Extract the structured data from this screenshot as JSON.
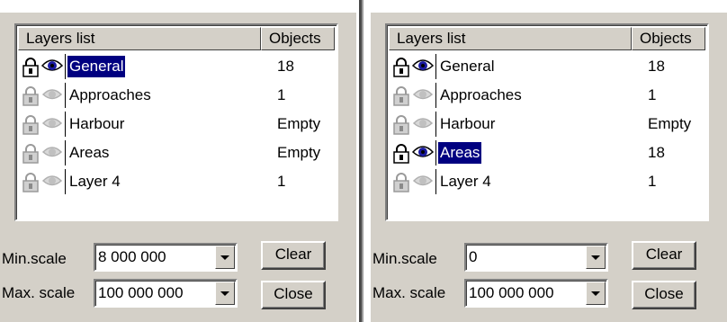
{
  "panels": [
    {
      "header": {
        "name": "Layers list",
        "objects": "Objects"
      },
      "layers": [
        {
          "name": "General",
          "objects": "18",
          "active": true,
          "selected": true
        },
        {
          "name": "Approaches",
          "objects": "1",
          "active": false,
          "selected": false
        },
        {
          "name": "Harbour",
          "objects": "Empty",
          "active": false,
          "selected": false
        },
        {
          "name": "Areas",
          "objects": "Empty",
          "active": false,
          "selected": false
        },
        {
          "name": "Layer 4",
          "objects": "1",
          "active": false,
          "selected": false
        }
      ],
      "min_scale_label": "Min.scale",
      "min_scale_value": "8 000 000",
      "max_scale_label": "Max. scale",
      "max_scale_value": "100 000 000",
      "clear_label": "Clear",
      "close_label": "Close"
    },
    {
      "header": {
        "name": "Layers list",
        "objects": "Objects"
      },
      "layers": [
        {
          "name": "General",
          "objects": "18",
          "active": true,
          "selected": false
        },
        {
          "name": "Approaches",
          "objects": "1",
          "active": false,
          "selected": false
        },
        {
          "name": "Harbour",
          "objects": "Empty",
          "active": false,
          "selected": false
        },
        {
          "name": "Areas",
          "objects": "18",
          "active": true,
          "selected": true
        },
        {
          "name": "Layer 4",
          "objects": "1",
          "active": false,
          "selected": false
        }
      ],
      "min_scale_label": "Min.scale",
      "min_scale_value": "0",
      "max_scale_label": "Max. scale",
      "max_scale_value": "100 000 000",
      "clear_label": "Clear",
      "close_label": "Close"
    }
  ],
  "colors": {
    "selection": "#000080",
    "panel": "#d4d0c8",
    "eye_active": "#1a1aa0"
  }
}
